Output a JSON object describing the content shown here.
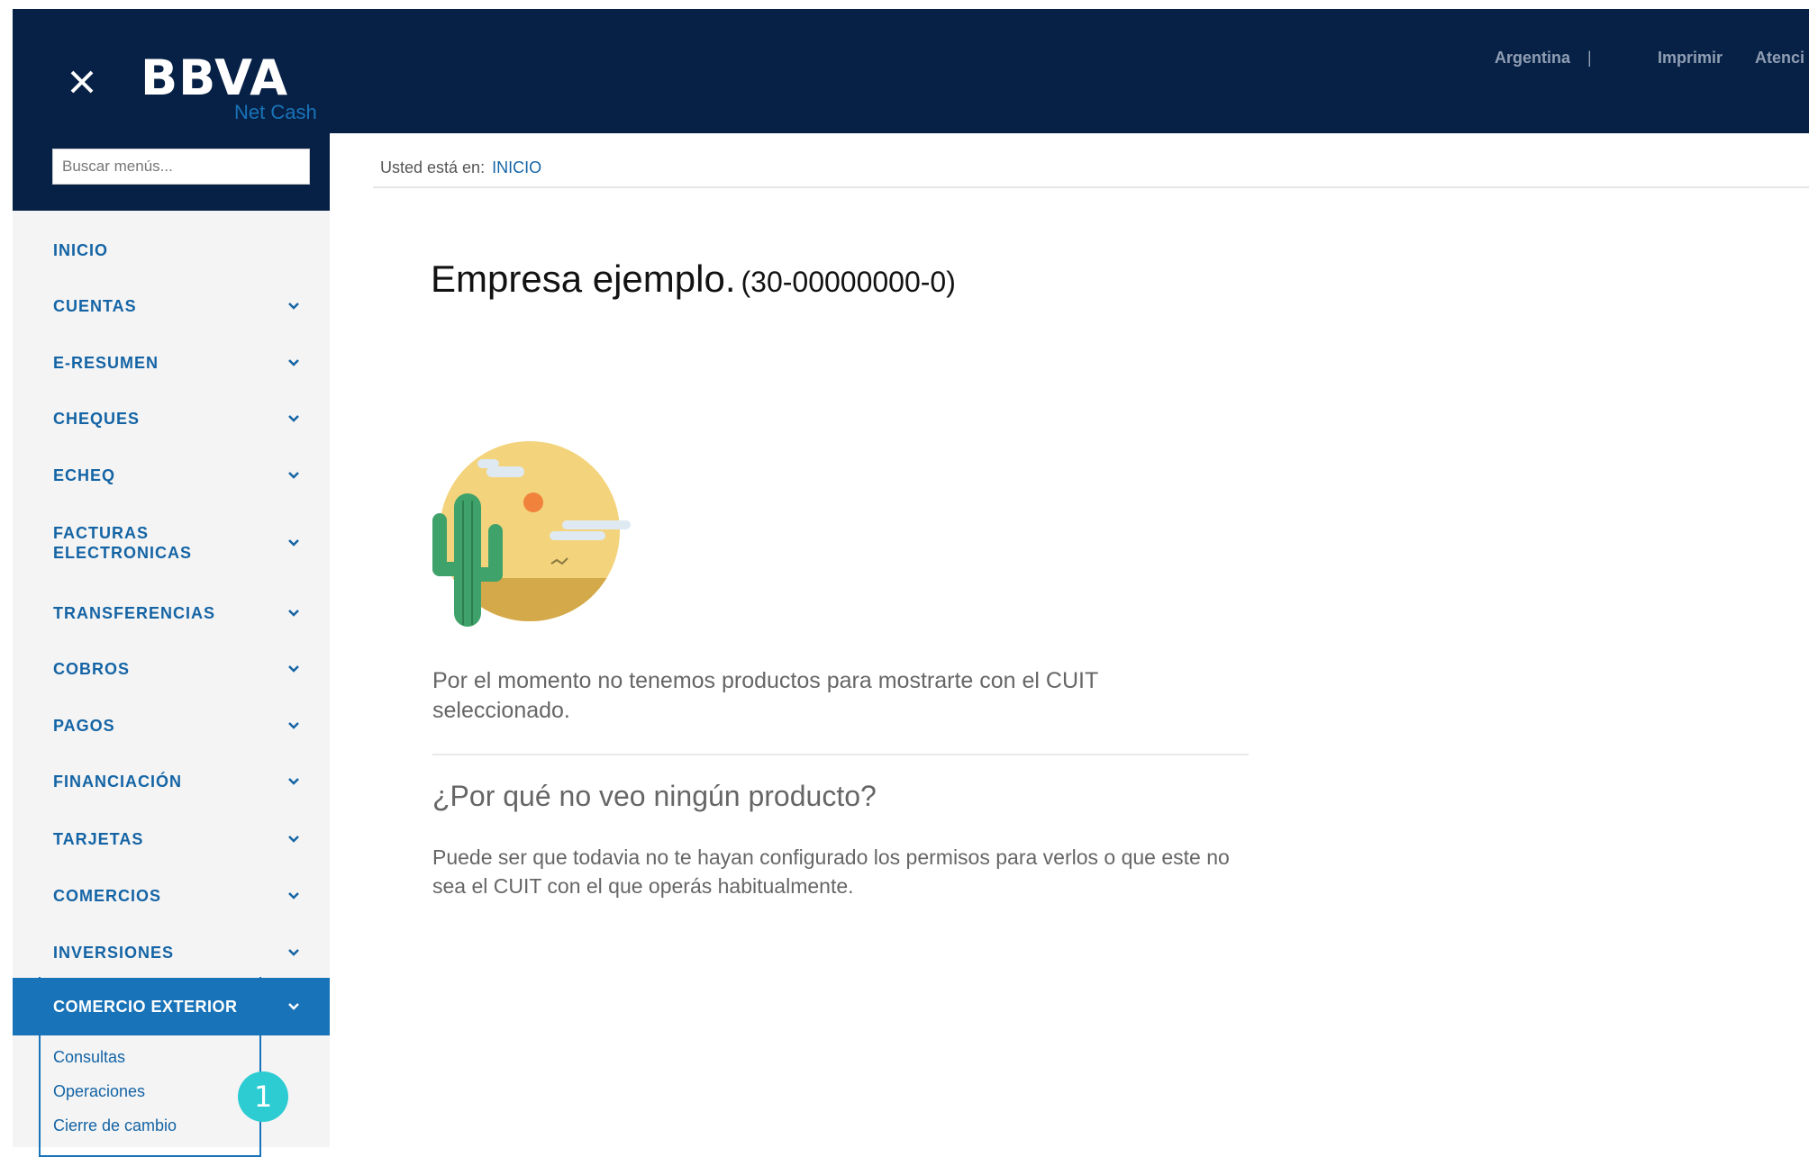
{
  "header": {
    "brand": "BBVA",
    "brand_sub": "Net Cash",
    "links": [
      "Argentina",
      "Imprimir",
      "Atenci"
    ],
    "separator": "|"
  },
  "sidebar": {
    "search_placeholder": "Buscar menús...",
    "items": [
      {
        "label": "INICIO",
        "has_chevron": false
      },
      {
        "label": "CUENTAS",
        "has_chevron": true
      },
      {
        "label": "E-RESUMEN",
        "has_chevron": true
      },
      {
        "label": "CHEQUES",
        "has_chevron": true
      },
      {
        "label": "ECHEQ",
        "has_chevron": true
      },
      {
        "label": "FACTURAS ELECTRONICAS",
        "has_chevron": true
      },
      {
        "label": "TRANSFERENCIAS",
        "has_chevron": true
      },
      {
        "label": "COBROS",
        "has_chevron": true
      },
      {
        "label": "PAGOS",
        "has_chevron": true
      },
      {
        "label": "FINANCIACIÓN",
        "has_chevron": true
      },
      {
        "label": "TARJETAS",
        "has_chevron": true
      },
      {
        "label": "COMERCIOS",
        "has_chevron": true
      },
      {
        "label": "INVERSIONES",
        "has_chevron": true
      },
      {
        "label": "COMERCIO EXTERIOR",
        "has_chevron": true,
        "active": true
      }
    ],
    "subitems": [
      "Consultas",
      "Operaciones",
      "Cierre de cambio"
    ],
    "badge": "1"
  },
  "breadcrumb": {
    "prefix": "Usted está en:",
    "current": "INICIO"
  },
  "main": {
    "company_name": "Empresa ejemplo.",
    "company_cuit": "(30-00000000-0)",
    "empty_message": "Por el momento no tenemos productos para mostrarte con el CUIT seleccionado.",
    "faq_question": "¿Por qué no veo ningún producto?",
    "faq_answer": "Puede ser que todavia no te hayan configurado los permisos para verlos o que este no sea el CUIT con el que operás habitualmente."
  },
  "colors": {
    "navy": "#072146",
    "accent": "#1973b8",
    "link": "#1464a5",
    "badge": "#2dccd3"
  }
}
